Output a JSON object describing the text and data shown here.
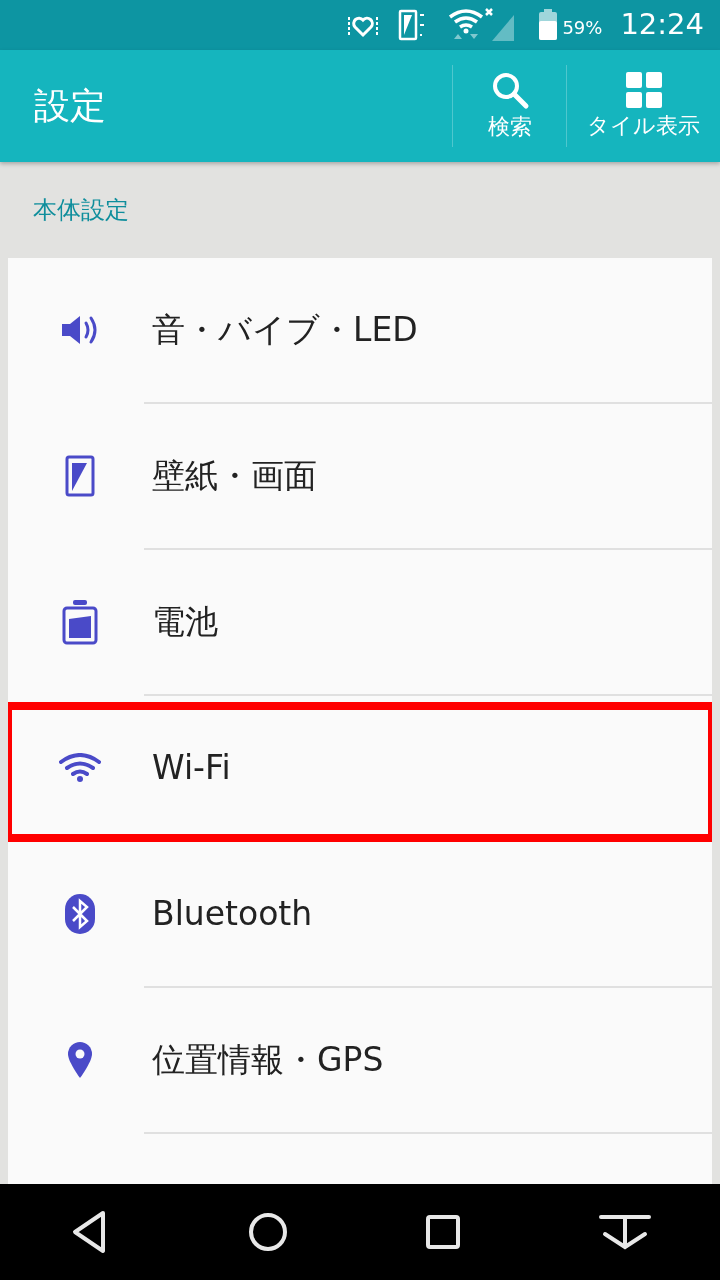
{
  "status_bar": {
    "battery": "59%",
    "time": "12:24"
  },
  "app_bar": {
    "title": "設定",
    "actions": [
      {
        "kind": "search",
        "label": "検索"
      },
      {
        "kind": "tiles",
        "label": "タイル表示"
      }
    ]
  },
  "section": {
    "title": "本体設定"
  },
  "items": [
    {
      "kind": "sound",
      "label": "音・バイブ・LED",
      "highlighted": false
    },
    {
      "kind": "display",
      "label": "壁紙・画面",
      "highlighted": false
    },
    {
      "kind": "battery",
      "label": "電池",
      "highlighted": false
    },
    {
      "kind": "wifi",
      "label": "Wi-Fi",
      "highlighted": true
    },
    {
      "kind": "bluetooth",
      "label": "Bluetooth",
      "highlighted": false
    },
    {
      "kind": "location",
      "label": "位置情報・GPS",
      "highlighted": false
    }
  ],
  "nav_bar": [
    {
      "kind": "back"
    },
    {
      "kind": "home"
    },
    {
      "kind": "recents"
    },
    {
      "kind": "hide"
    }
  ]
}
